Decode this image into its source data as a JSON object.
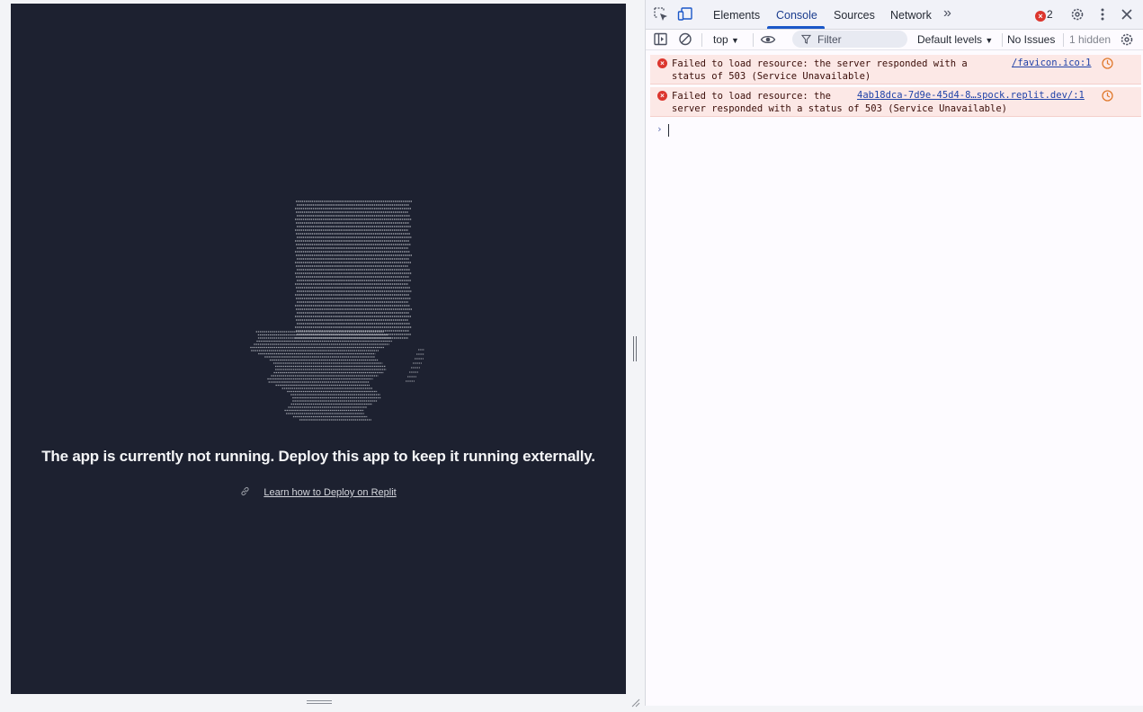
{
  "viewport": {
    "message": "The app is currently not running. Deploy this app to keep it running externally.",
    "link_text": "Learn how to Deploy on Replit",
    "icons": {
      "illustration": "ascii-bottle-illustration",
      "link": "link-icon"
    }
  },
  "devtools": {
    "tabs": [
      {
        "label": "Elements",
        "active": false
      },
      {
        "label": "Console",
        "active": true
      },
      {
        "label": "Sources",
        "active": false
      },
      {
        "label": "Network",
        "active": false
      }
    ],
    "more_tabs_glyph": "»",
    "error_count": "2",
    "toolbar": {
      "context": "top",
      "filter_placeholder": "Filter",
      "levels": "Default levels",
      "issues": "No Issues",
      "hidden": "1 hidden"
    },
    "messages": [
      {
        "line1": "Failed to load resource: the server responded with a",
        "line2": "status of 503 (Service Unavailable)",
        "source": "/favicon.ico:1"
      },
      {
        "line1": "Failed to load resource: the",
        "line2": "server responded with a status of 503 (Service Unavailable)",
        "source": "4ab18dca-7d9e-45d4-8…spock.replit.dev/:1"
      }
    ],
    "prompt_glyph": "›",
    "accent_color": "#1a57c8",
    "error_color": "#dc362e"
  }
}
